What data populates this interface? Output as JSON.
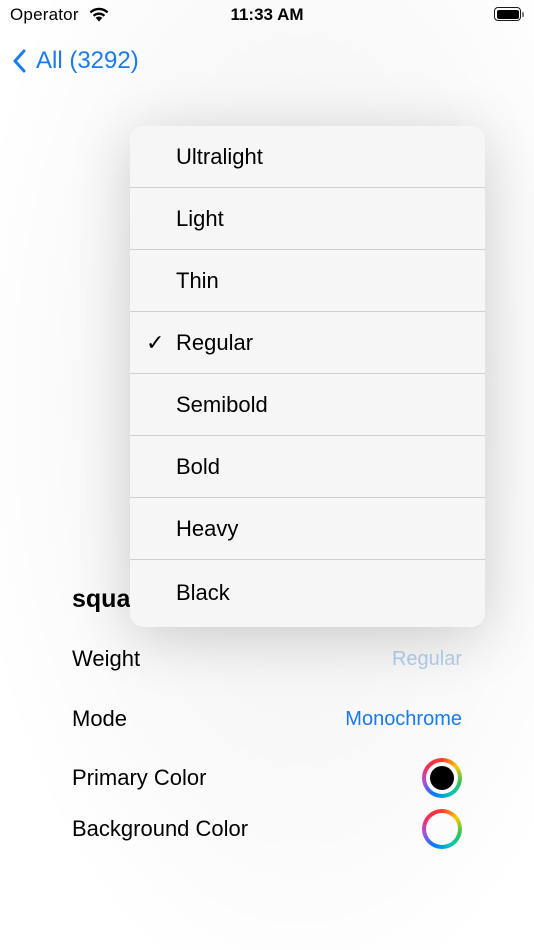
{
  "status_bar": {
    "carrier": "Operator",
    "time": "11:33 AM"
  },
  "nav": {
    "back_label": "All (3292)"
  },
  "detail": {
    "title": "squa",
    "rows": [
      {
        "label": "Weight",
        "value": "Regular"
      },
      {
        "label": "Mode",
        "value": "Monochrome"
      },
      {
        "label": "Primary Color"
      },
      {
        "label": "Background Color"
      }
    ]
  },
  "weight_menu": {
    "selected": "Regular",
    "check_glyph": "✓",
    "items": [
      {
        "label": "Ultralight"
      },
      {
        "label": "Light"
      },
      {
        "label": "Thin"
      },
      {
        "label": "Regular"
      },
      {
        "label": "Semibold"
      },
      {
        "label": "Bold"
      },
      {
        "label": "Heavy"
      },
      {
        "label": "Black"
      }
    ]
  },
  "colors": {
    "accent": "#1a7cf3",
    "disabled_accent": "#b8d3f5",
    "primary_color": "#000000"
  },
  "icons": [
    "wifi-icon",
    "battery-icon",
    "chevron-left-icon",
    "checkmark-icon",
    "color-wheel-icon"
  ]
}
